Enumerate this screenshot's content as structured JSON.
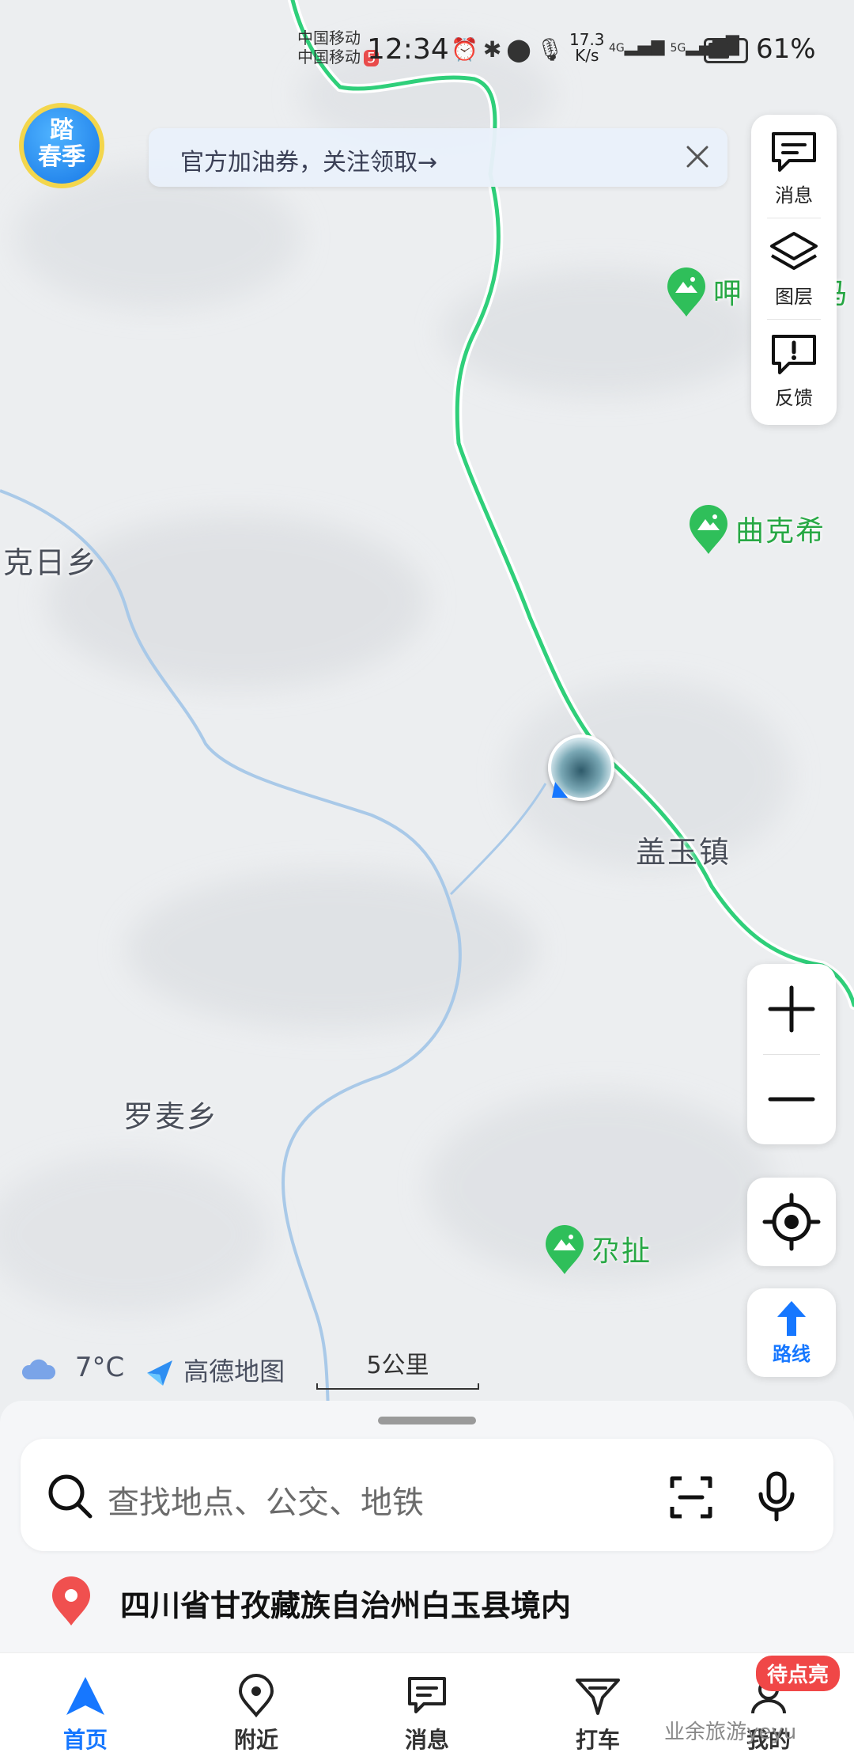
{
  "status_bar": {
    "carrier_1": "中国移动",
    "carrier_2": "中国移动",
    "carrier_badge": "5",
    "time": "12:34",
    "net_speed_value": "17.3",
    "net_speed_unit": "K/s",
    "net_1": "4G",
    "net_2": "5G",
    "battery_level": 0.61,
    "battery_text": "61%"
  },
  "banner": {
    "text": "官方加油券，关注领取→"
  },
  "promo_badge": {
    "line1": "踏",
    "line2": "春季"
  },
  "tools": {
    "messages": "消息",
    "layers": "图层",
    "feedback": "反馈",
    "route": "路线"
  },
  "map": {
    "places": [
      "克日乡",
      "盖玉镇",
      "罗麦乡"
    ],
    "pois": [
      "呷",
      "曲克希",
      "尕扯"
    ],
    "pois_extra": "马",
    "weather_temp": "7°C",
    "brand": "高德地图",
    "scale": "5公里",
    "colors": {
      "road": "#2fcf7a",
      "river": "#9ec3e8",
      "poi": "#27a844",
      "accent": "#1677ff"
    }
  },
  "search": {
    "placeholder": "查找地点、公交、地铁"
  },
  "location": {
    "text": "四川省甘孜藏族自治州白玉县境内"
  },
  "tabs": [
    {
      "label": "首页",
      "icon": "navigate-icon",
      "active": true
    },
    {
      "label": "附近",
      "icon": "location-pin-icon"
    },
    {
      "label": "消息",
      "icon": "message-icon"
    },
    {
      "label": "打车",
      "icon": "taxi-icon"
    },
    {
      "label": "我的",
      "icon": "profile-icon"
    }
  ],
  "badge": "待点亮",
  "watermark": "业余旅游yeyu"
}
